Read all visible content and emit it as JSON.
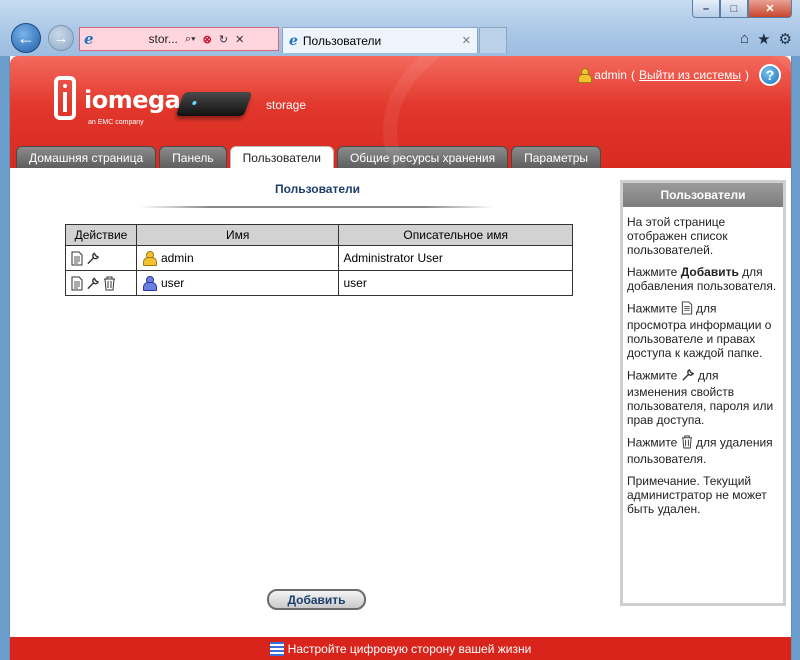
{
  "browser": {
    "address_text": "stor...",
    "tab_title": "Пользователи"
  },
  "header": {
    "device_name": "storage",
    "logo_word": "iomega",
    "logo_tag": "an EMC company",
    "user": "admin",
    "logout_open": "(",
    "logout_label": "Выйти из системы",
    "logout_close": ")",
    "help_label": "?"
  },
  "nav": {
    "tabs": [
      {
        "label": "Домашняя страница",
        "active": false
      },
      {
        "label": "Панель",
        "active": false
      },
      {
        "label": "Пользователи",
        "active": true
      },
      {
        "label": "Общие ресурсы хранения",
        "active": false
      },
      {
        "label": "Параметры",
        "active": false
      }
    ]
  },
  "main": {
    "title": "Пользователи",
    "columns": [
      "Действие",
      "Имя",
      "Описательное имя"
    ],
    "rows": [
      {
        "name": "admin",
        "description": "Administrator User",
        "deletable": false
      },
      {
        "name": "user",
        "description": "user",
        "deletable": true
      }
    ],
    "add_button": "Добавить"
  },
  "sidebar": {
    "title": "Пользователи",
    "p1": "На этой странице отображен список пользователей.",
    "p2_pre": "Нажмите ",
    "p2_bold": "Добавить",
    "p2_post": " для добавления пользователя.",
    "p3_pre": "Нажмите ",
    "p3_post": " для просмотра информации о пользователе и правах доступа к каждой папке.",
    "p4_pre": "Нажмите ",
    "p4_post": " для изменения свойств пользователя, пароля или прав доступа.",
    "p5_pre": "Нажмите ",
    "p5_post": " для удаления пользователя.",
    "p6": "Примечание. Текущий администратор не может быть удален."
  },
  "footer": {
    "text": "Настройте цифровую сторону вашей жизни"
  },
  "icons": {
    "view": "document-icon",
    "edit": "wrench-icon",
    "delete": "trash-icon",
    "admin_user": "user-gold-icon",
    "regular_user": "user-blue-icon"
  }
}
